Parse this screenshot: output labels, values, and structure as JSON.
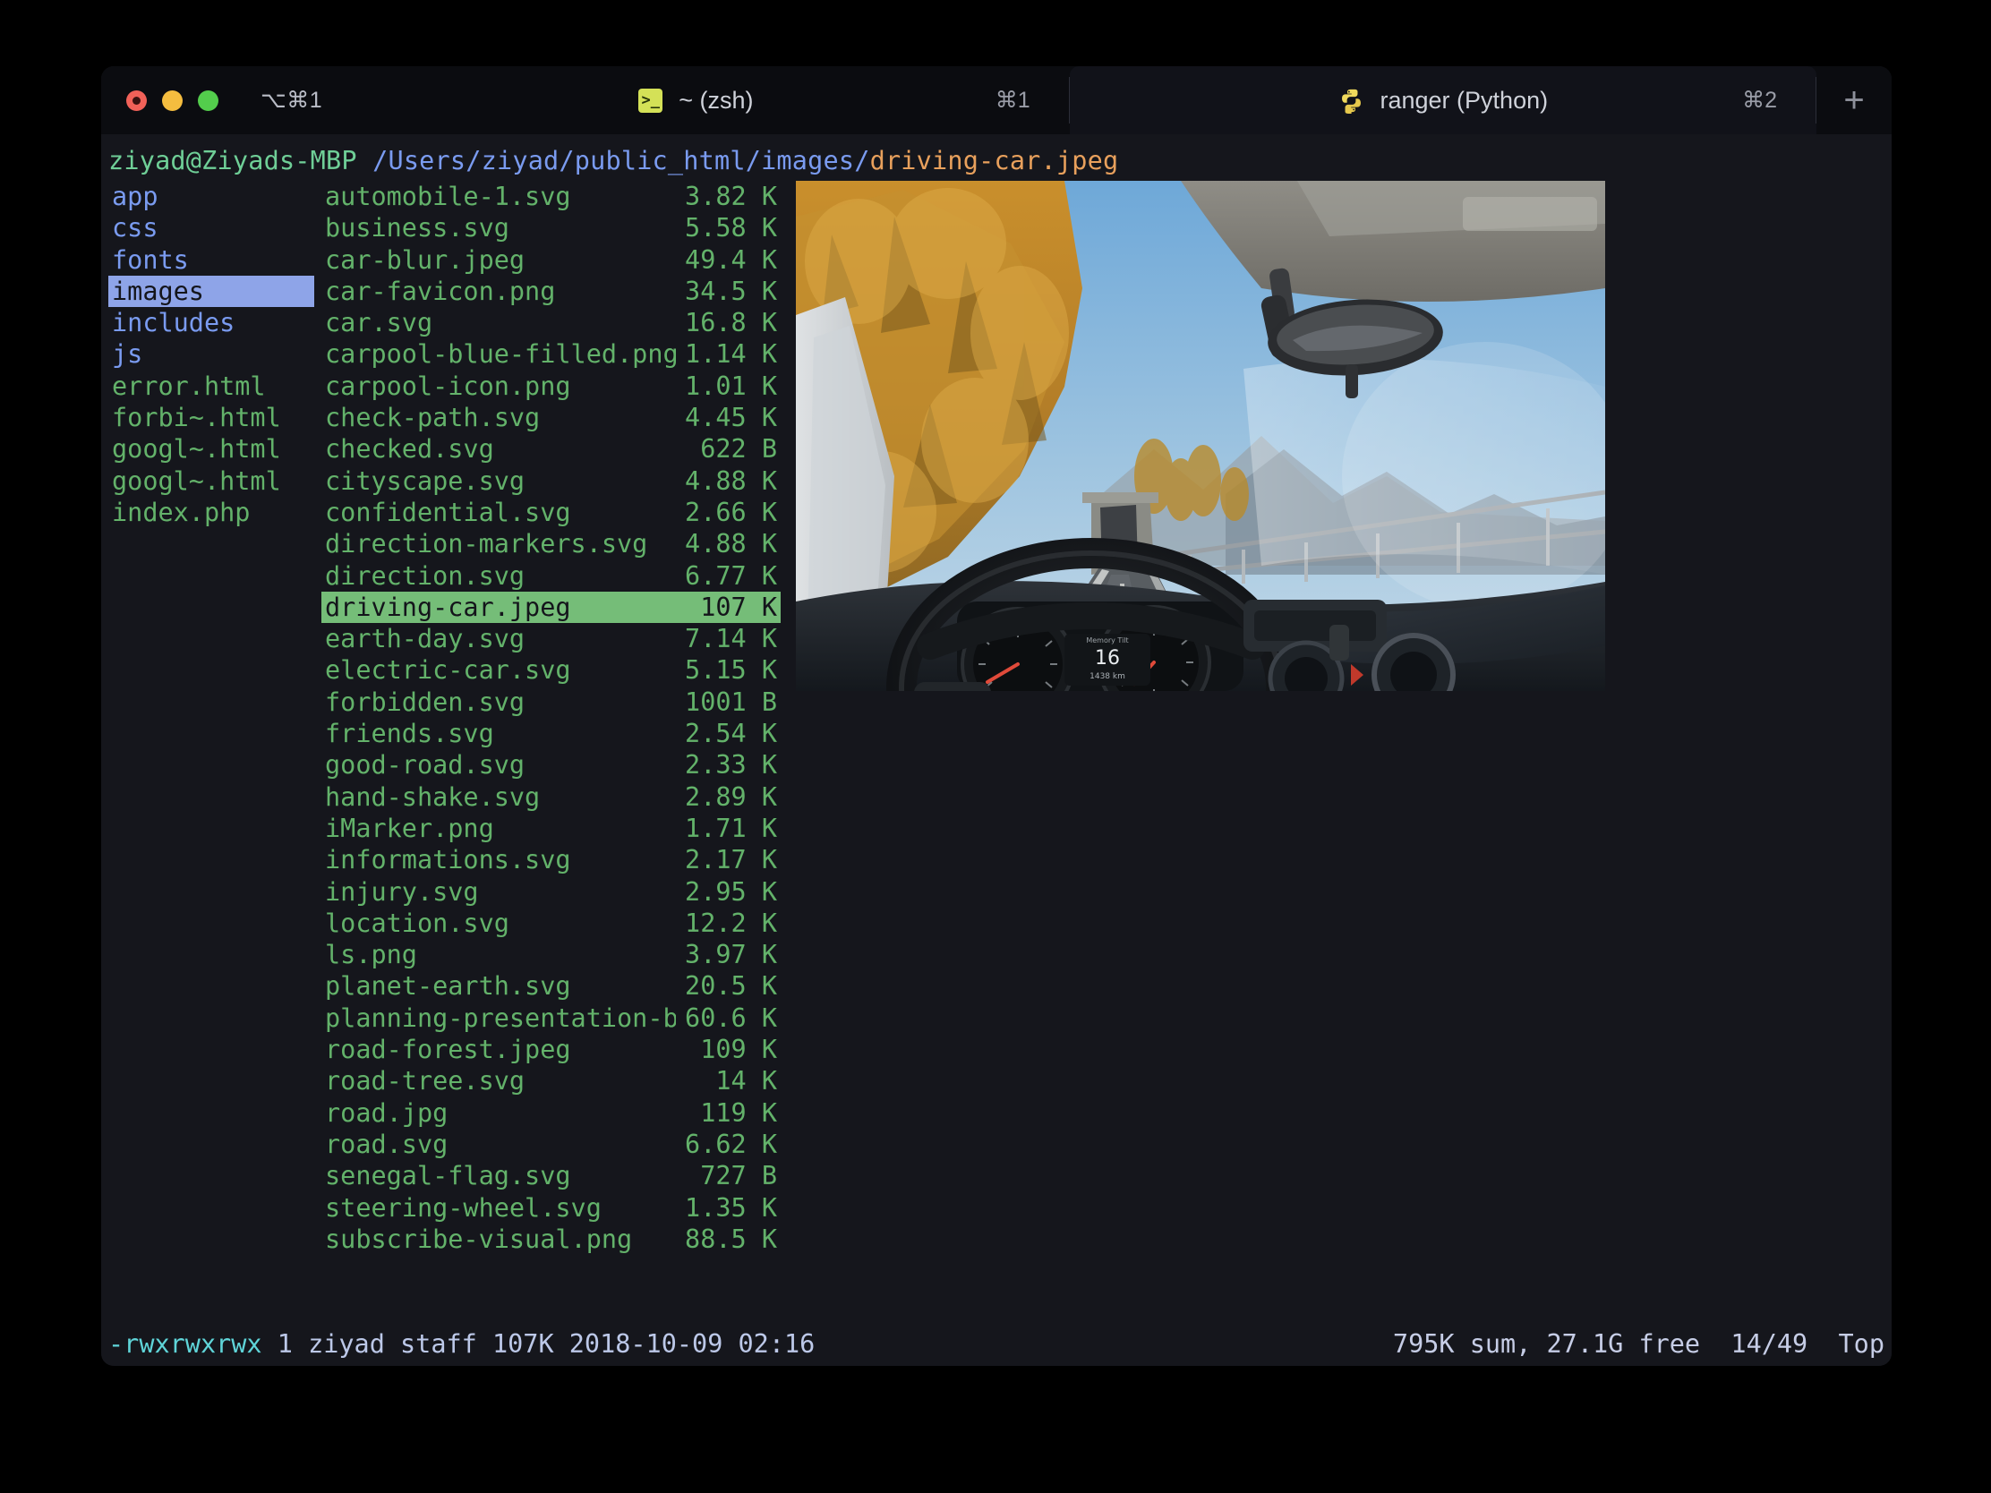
{
  "window": {
    "traffic_lights": [
      "close",
      "minimize",
      "maximize"
    ],
    "shortcut": "⌥⌘1"
  },
  "tabs": [
    {
      "icon": "terminal-prompt-icon",
      "glyph": ">_",
      "label": "~ (zsh)",
      "shortcut": "⌘1",
      "active": false
    },
    {
      "icon": "python-logo-icon",
      "label": "ranger (Python)",
      "shortcut": "⌘2",
      "active": true
    }
  ],
  "new_tab": {
    "label": "+"
  },
  "path": {
    "host": "ziyad@Ziyads-MBP",
    "directory": "/Users/ziyad/public_html/images/",
    "filename": "driving-car.jpeg"
  },
  "left_panel": [
    {
      "name": "app",
      "type": "dir",
      "selected": false
    },
    {
      "name": "css",
      "type": "dir",
      "selected": false
    },
    {
      "name": "fonts",
      "type": "dir",
      "selected": false
    },
    {
      "name": "images",
      "type": "dir",
      "selected": true
    },
    {
      "name": "includes",
      "type": "dir",
      "selected": false
    },
    {
      "name": "js",
      "type": "dir",
      "selected": false
    },
    {
      "name": "error.html",
      "type": "file",
      "selected": false
    },
    {
      "name": "forbi~.html",
      "type": "file",
      "selected": false
    },
    {
      "name": "googl~.html",
      "type": "file",
      "selected": false
    },
    {
      "name": "googl~.html",
      "type": "file",
      "selected": false
    },
    {
      "name": "index.php",
      "type": "file",
      "selected": false
    }
  ],
  "file_list": [
    {
      "name": "automobile-1.svg",
      "size": "3.82 K",
      "selected": false
    },
    {
      "name": "business.svg",
      "size": "5.58 K",
      "selected": false
    },
    {
      "name": "car-blur.jpeg",
      "size": "49.4 K",
      "selected": false
    },
    {
      "name": "car-favicon.png",
      "size": "34.5 K",
      "selected": false
    },
    {
      "name": "car.svg",
      "size": "16.8 K",
      "selected": false
    },
    {
      "name": "carpool-blue-filled.png",
      "size": "1.14 K",
      "selected": false
    },
    {
      "name": "carpool-icon.png",
      "size": "1.01 K",
      "selected": false
    },
    {
      "name": "check-path.svg",
      "size": "4.45 K",
      "selected": false
    },
    {
      "name": "checked.svg",
      "size": "622 B",
      "selected": false
    },
    {
      "name": "cityscape.svg",
      "size": "4.88 K",
      "selected": false
    },
    {
      "name": "confidential.svg",
      "size": "2.66 K",
      "selected": false
    },
    {
      "name": "direction-markers.svg",
      "size": "4.88 K",
      "selected": false
    },
    {
      "name": "direction.svg",
      "size": "6.77 K",
      "selected": false
    },
    {
      "name": "driving-car.jpeg",
      "size": "107 K",
      "selected": true
    },
    {
      "name": "earth-day.svg",
      "size": "7.14 K",
      "selected": false
    },
    {
      "name": "electric-car.svg",
      "size": "5.15 K",
      "selected": false
    },
    {
      "name": "forbidden.svg",
      "size": "1001 B",
      "selected": false
    },
    {
      "name": "friends.svg",
      "size": "2.54 K",
      "selected": false
    },
    {
      "name": "good-road.svg",
      "size": "2.33 K",
      "selected": false
    },
    {
      "name": "hand-shake.svg",
      "size": "2.89 K",
      "selected": false
    },
    {
      "name": "iMarker.png",
      "size": "1.71 K",
      "selected": false
    },
    {
      "name": "informations.svg",
      "size": "2.17 K",
      "selected": false
    },
    {
      "name": "injury.svg",
      "size": "2.95 K",
      "selected": false
    },
    {
      "name": "location.svg",
      "size": "12.2 K",
      "selected": false
    },
    {
      "name": "ls.png",
      "size": "3.97 K",
      "selected": false
    },
    {
      "name": "planet-earth.svg",
      "size": "20.5 K",
      "selected": false
    },
    {
      "name": "planning-presentation-bann~.png",
      "size": "60.6 K",
      "selected": false
    },
    {
      "name": "road-forest.jpeg",
      "size": "109 K",
      "selected": false
    },
    {
      "name": "road-tree.svg",
      "size": "14 K",
      "selected": false
    },
    {
      "name": "road.jpg",
      "size": "119 K",
      "selected": false
    },
    {
      "name": "road.svg",
      "size": "6.62 K",
      "selected": false
    },
    {
      "name": "senegal-flag.svg",
      "size": "727 B",
      "selected": false
    },
    {
      "name": "steering-wheel.svg",
      "size": "1.35 K",
      "selected": false
    },
    {
      "name": "subscribe-visual.png",
      "size": "88.5 K",
      "selected": false
    }
  ],
  "preview": {
    "alt": "driving-car.jpeg preview: view from inside a car driving on a mountain road with autumn larch trees"
  },
  "status": {
    "permissions": "-rwxrwxrwx",
    "details": " 1 ziyad staff 107K 2018-10-09 02:16",
    "right": "795K sum, 27.1G free  14/49  Top"
  },
  "colors": {
    "window_bg": "#15161c",
    "tabbar_bg": "#0b0c10",
    "dir_color": "#7a9bf0",
    "file_color": "#63b26a",
    "dir_select_bg": "#8ea4e8",
    "file_select_bg": "#75bd78",
    "host_color": "#6fcf97",
    "path_color": "#7a9bf0",
    "filename_color": "#e8a05c",
    "perm_color": "#5fd4d8"
  }
}
